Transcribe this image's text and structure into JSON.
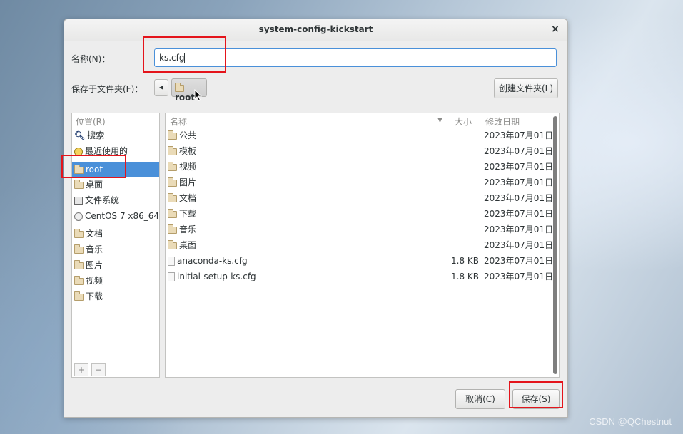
{
  "dialog": {
    "title": "system-config-kickstart",
    "close_glyph": "×",
    "name_label": "名称(N)：",
    "name_value": "ks.cfg",
    "save_in_label": "保存于文件夹(F)：",
    "back_glyph": "◀",
    "path_segment": "root",
    "create_folder_label": "创建文件夹(L)",
    "cancel_label": "取消(C)",
    "save_label": "保存(S)"
  },
  "places": {
    "header": "位置(R)",
    "items": [
      {
        "label": "搜索",
        "icon": "search-icon"
      },
      {
        "label": "最近使用的",
        "icon": "recent-icon"
      },
      {
        "label": "root",
        "icon": "folder-icon",
        "selected": true
      },
      {
        "label": "桌面",
        "icon": "folder-icon"
      },
      {
        "label": "文件系统",
        "icon": "filesystem-icon"
      },
      {
        "label": "CentOS 7 x86_64",
        "icon": "disc-icon"
      },
      {
        "label": "文档",
        "icon": "folder-icon"
      },
      {
        "label": "音乐",
        "icon": "folder-icon"
      },
      {
        "label": "图片",
        "icon": "folder-icon"
      },
      {
        "label": "视频",
        "icon": "folder-icon"
      },
      {
        "label": "下载",
        "icon": "folder-icon"
      }
    ],
    "add_glyph": "+",
    "remove_glyph": "−"
  },
  "files": {
    "columns": {
      "name": "名称",
      "size": "大小",
      "modified": "修改日期"
    },
    "rows": [
      {
        "name": "公共",
        "size": "",
        "date": "2023年07月01日",
        "type": "folder"
      },
      {
        "name": "模板",
        "size": "",
        "date": "2023年07月01日",
        "type": "folder"
      },
      {
        "name": "视频",
        "size": "",
        "date": "2023年07月01日",
        "type": "folder"
      },
      {
        "name": "图片",
        "size": "",
        "date": "2023年07月01日",
        "type": "folder"
      },
      {
        "name": "文档",
        "size": "",
        "date": "2023年07月01日",
        "type": "folder"
      },
      {
        "name": "下载",
        "size": "",
        "date": "2023年07月01日",
        "type": "folder"
      },
      {
        "name": "音乐",
        "size": "",
        "date": "2023年07月01日",
        "type": "folder"
      },
      {
        "name": "桌面",
        "size": "",
        "date": "2023年07月01日",
        "type": "folder"
      },
      {
        "name": "anaconda-ks.cfg",
        "size": "1.8 KB",
        "date": "2023年07月01日",
        "type": "file"
      },
      {
        "name": "initial-setup-ks.cfg",
        "size": "1.8 KB",
        "date": "2023年07月01日",
        "type": "file"
      }
    ]
  },
  "watermark": "CSDN @QChestnut",
  "colors": {
    "selection": "#4a90d9",
    "highlight_box": "#e4141b",
    "focus_border": "#4a90d9"
  }
}
